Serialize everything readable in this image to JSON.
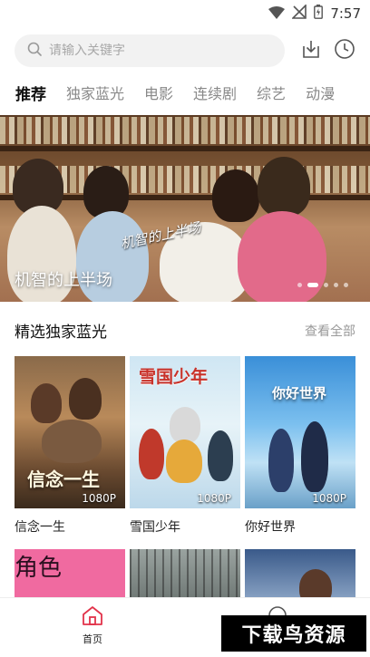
{
  "status_bar": {
    "time": "7:57",
    "icons": [
      "wifi-icon",
      "signal-off-icon",
      "battery-icon"
    ]
  },
  "search": {
    "placeholder": "请输入关键字"
  },
  "tabs": [
    {
      "label": "推荐",
      "active": true
    },
    {
      "label": "独家蓝光"
    },
    {
      "label": "电影"
    },
    {
      "label": "连续剧"
    },
    {
      "label": "综艺"
    },
    {
      "label": "动漫"
    }
  ],
  "banner": {
    "title": "机智的上半场",
    "art_text": "机智的上半场",
    "page_count": 5,
    "active_index": 1
  },
  "section": {
    "title": "精选独家蓝光",
    "see_all": "查看全部"
  },
  "movies": [
    {
      "name": "信念一生",
      "quality": "1080P",
      "art": "信念一生"
    },
    {
      "name": "雪国少年",
      "quality": "1080P",
      "art": "雪国少年"
    },
    {
      "name": "你好世界",
      "quality": "1080P",
      "art": "你好世界"
    }
  ],
  "second_row_art": [
    "角色"
  ],
  "bottom_nav": {
    "home_label": "首页"
  },
  "watermark": "下载鸟资源",
  "colors": {
    "accent": "#e2334a"
  }
}
